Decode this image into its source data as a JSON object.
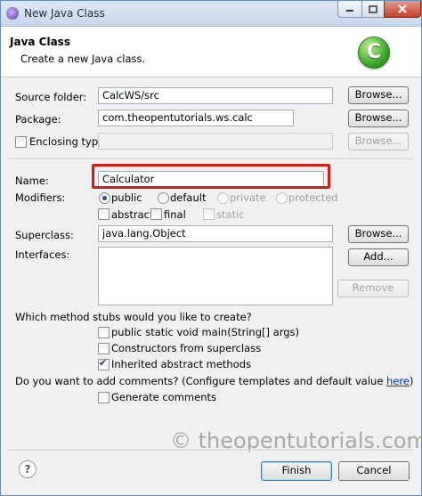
{
  "window": {
    "title": "New Java Class"
  },
  "header": {
    "title": "Java Class",
    "subtitle": "Create a new Java class.",
    "icon": "class-c-icon",
    "icon_letter": "C"
  },
  "form": {
    "source_folder": {
      "label": "Source folder:",
      "value": "CalcWS/src",
      "browse": "Browse..."
    },
    "package": {
      "label": "Package:",
      "value": "com.theopentutorials.ws.calc",
      "browse": "Browse..."
    },
    "enclosing_type": {
      "label": "Enclosing type:",
      "value": "",
      "checked": false,
      "browse": "Browse..."
    },
    "name": {
      "label": "Name:",
      "value": "Calculator"
    },
    "modifiers": {
      "label": "Modifiers:",
      "access": [
        "public",
        "default",
        "private",
        "protected"
      ],
      "selected": "public",
      "abstract": "abstract",
      "final": "final",
      "static": "static"
    },
    "superclass": {
      "label": "Superclass:",
      "value": "java.lang.Object",
      "browse": "Browse..."
    },
    "interfaces": {
      "label": "Interfaces:",
      "add": "Add...",
      "remove": "Remove"
    },
    "stubs": {
      "question": "Which method stubs would you like to create?",
      "options": [
        {
          "label": "public static void main(String[] args)",
          "checked": false
        },
        {
          "label": "Constructors from superclass",
          "checked": false
        },
        {
          "label": "Inherited abstract methods",
          "checked": true
        }
      ]
    },
    "comments": {
      "question_prefix": "Do you want to add comments? (Configure templates and default value ",
      "link": "here",
      "question_suffix": ")",
      "generate": "Generate comments",
      "checked": false
    }
  },
  "watermark": "© theopentutorials.com",
  "footer": {
    "finish": "Finish",
    "cancel": "Cancel"
  },
  "colors": {
    "highlight": "#d21c1c",
    "link": "#0033cc",
    "accent": "#3c7fb1"
  }
}
